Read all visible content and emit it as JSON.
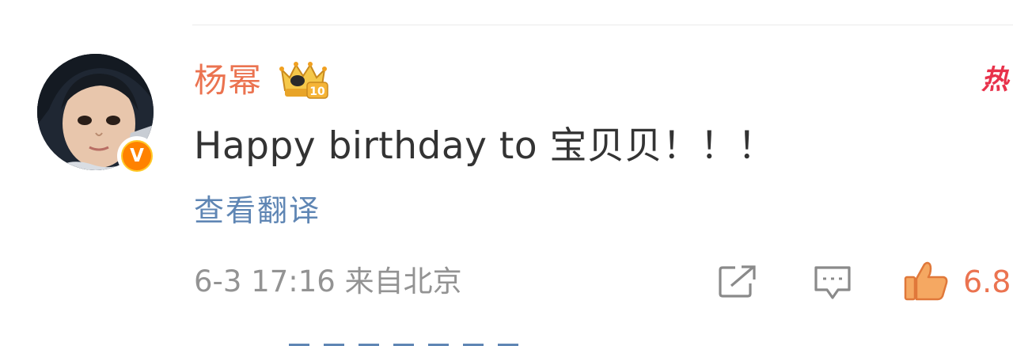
{
  "post": {
    "username": "杨幂",
    "hot_tag": "热",
    "comment_text": "Happy birthday to 宝贝贝！！！",
    "translate_label": "查看翻译",
    "timestamp": "6-3 17:16 来自北京",
    "like_count": "6.8",
    "verified_badge": "V",
    "level_badge": "10"
  },
  "icons": {
    "share": "share-external-icon",
    "comment": "comment-bubble-icon",
    "like": "thumbs-up-icon",
    "crown": "crown-level-icon"
  },
  "colors": {
    "username": "#eb7350",
    "translate_link": "#5f86b4",
    "meta_text": "#939393",
    "comment_text": "#333333",
    "hot_tag": "#e8324b",
    "verified_badge": "#ff8200",
    "like_icon": "#f08c3c"
  }
}
